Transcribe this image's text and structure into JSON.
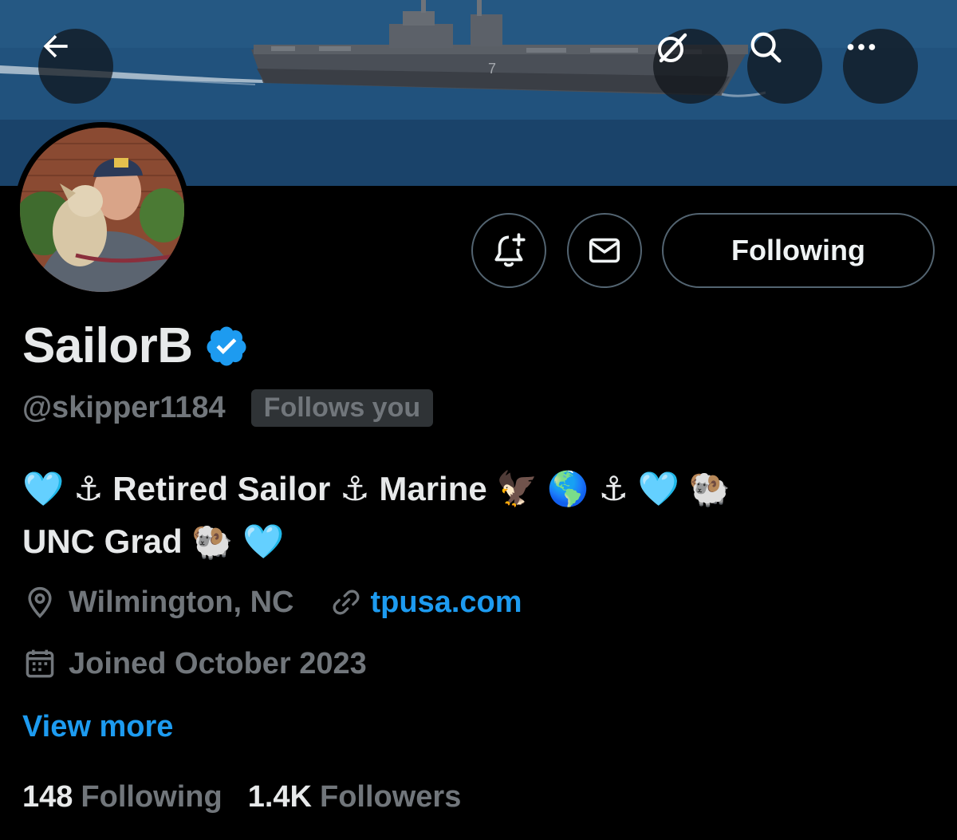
{
  "profile": {
    "display_name": "SailorB",
    "handle": "@skipper1184",
    "follows_you": "Follows you",
    "bio_line1": "🩵 ⚓ Retired Sailor ⚓ Marine 🦅 🌎 ⚓ 🩵 🐏",
    "bio_line2": "UNC Grad 🐏 🩵",
    "location": "Wilmington, NC",
    "website": "tpusa.com",
    "joined": "Joined October 2023",
    "view_more": "View more"
  },
  "actions": {
    "following_label": "Following"
  },
  "stats": {
    "following_count": "148",
    "following_label": "Following",
    "followers_count": "1.4K",
    "followers_label": "Followers"
  },
  "icons": {
    "back": "back-arrow-icon",
    "grok": "grok-icon",
    "search": "search-icon",
    "more": "more-icon",
    "notify": "bell-plus-icon",
    "message": "envelope-icon",
    "verified": "verified-badge-icon",
    "location": "location-pin-icon",
    "link": "link-icon",
    "calendar": "calendar-icon"
  },
  "colors": {
    "accent": "#1d9bf0",
    "background": "#000000",
    "secondary_text": "#71767b",
    "primary_text": "#e7e9ea"
  }
}
